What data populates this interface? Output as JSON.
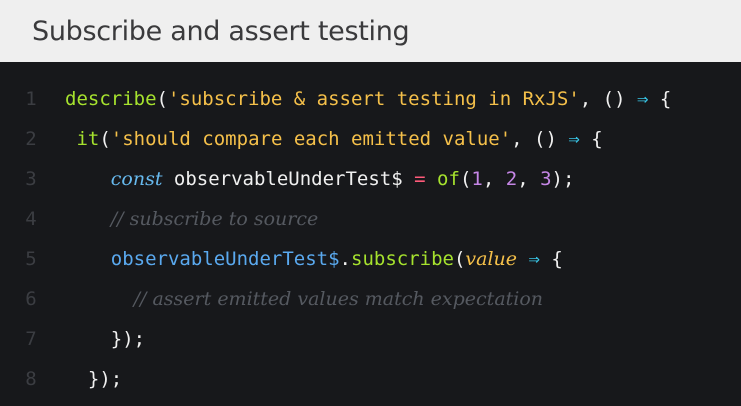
{
  "header": {
    "title": "Subscribe and assert testing"
  },
  "code": {
    "line_numbers": [
      "1",
      "2",
      "3",
      "4",
      "5",
      "6",
      "7",
      "8"
    ],
    "l1": {
      "fn": "describe",
      "open": "(",
      "str": "'subscribe & assert testing in RxJS'",
      "mid": ", () ",
      "arrow": "⇒",
      "end": " {"
    },
    "l2": {
      "fn": "it",
      "open": "(",
      "str": "'should compare each emitted value'",
      "mid": ", () ",
      "arrow": "⇒",
      "end": " {"
    },
    "l3": {
      "kw": "const",
      "id": " observableUnderTest$ ",
      "op": "=",
      "sp": " ",
      "fn": "of",
      "open": "(",
      "n1": "1",
      "c1": ", ",
      "n2": "2",
      "c2": ", ",
      "n3": "3",
      "end": ");"
    },
    "l4": {
      "comment": "// subscribe to source"
    },
    "l5": {
      "var": "observableUnderTest$",
      "dot": ".",
      "fn": "subscribe",
      "open": "(",
      "param": "value",
      "sp": " ",
      "arrow": "⇒",
      "end": " {"
    },
    "l6": {
      "comment": "// assert emitted values match expectation"
    },
    "l7": {
      "close": "});"
    },
    "l8": {
      "close": "});"
    }
  }
}
